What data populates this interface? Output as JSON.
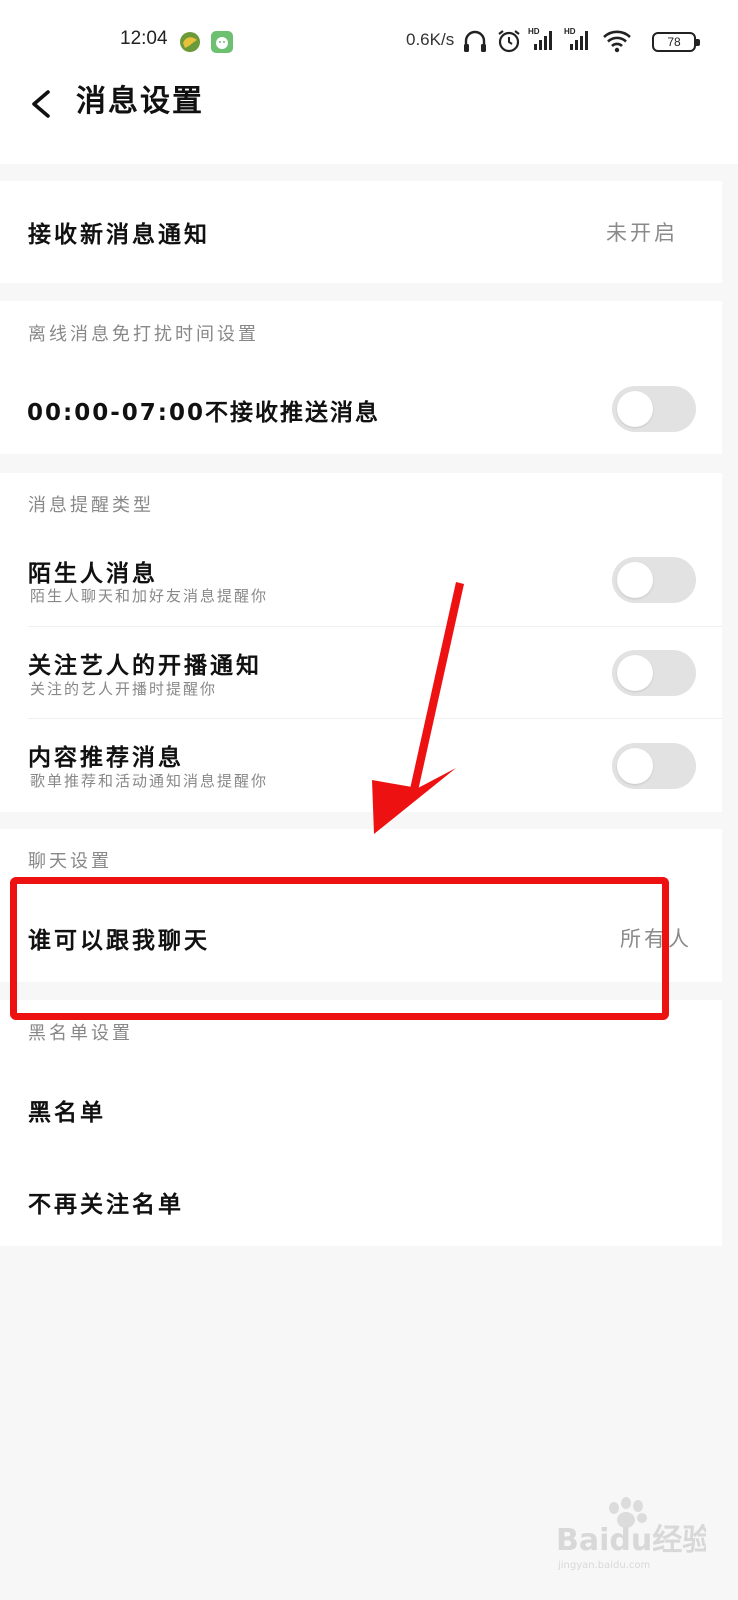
{
  "status_bar": {
    "time": "12:04",
    "net_speed": "0.6K/s",
    "battery": "78",
    "icons": [
      "app-icon-1",
      "app-icon-2",
      "headphones-icon",
      "alarm-icon",
      "hd-signal-icon",
      "hd-signal-icon",
      "wifi-icon",
      "battery-icon"
    ]
  },
  "header": {
    "title": "消息设置",
    "back_icon": "chevron-left-icon"
  },
  "receive_notification": {
    "label": "接收新消息通知",
    "value": "未开启"
  },
  "dnd": {
    "section_label": "离线消息免打扰时间设置",
    "row_label": "00:00-07:00不接收推送消息",
    "enabled": false
  },
  "reminder_types": {
    "section_label": "消息提醒类型",
    "items": [
      {
        "title": "陌生人消息",
        "subtitle": "陌生人聊天和加好友消息提醒你",
        "enabled": false
      },
      {
        "title": "关注艺人的开播通知",
        "subtitle": "关注的艺人开播时提醒你",
        "enabled": false
      },
      {
        "title": "内容推荐消息",
        "subtitle": "歌单推荐和活动通知消息提醒你",
        "enabled": false
      }
    ]
  },
  "chat": {
    "section_label": "聊天设置",
    "row_label": "谁可以跟我聊天",
    "value": "所有人"
  },
  "blacklist": {
    "section_label": "黑名单设置",
    "items": [
      "黑名单",
      "不再关注名单"
    ]
  },
  "annotation": {
    "color": "#ee1111"
  },
  "watermark": {
    "text": "Baidu经验",
    "subtext": "jingyan.baidu.com"
  }
}
